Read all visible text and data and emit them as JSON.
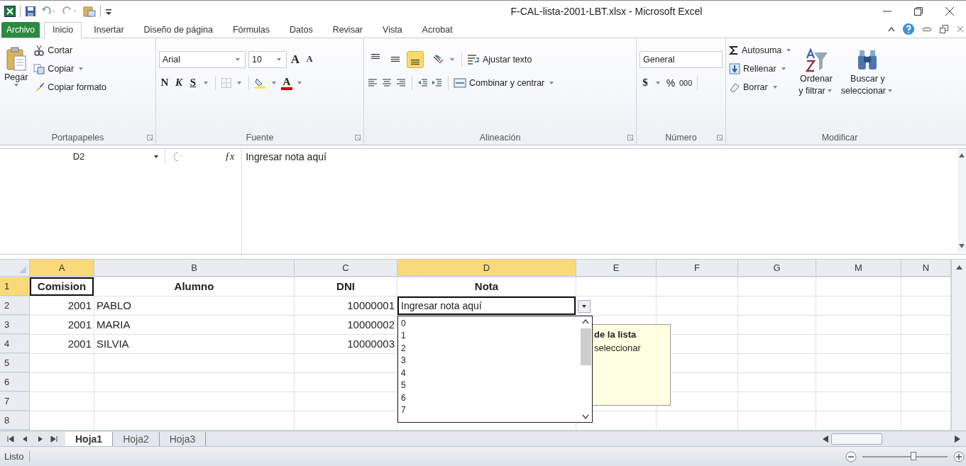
{
  "window": {
    "title": "F-CAL-lista-2001-LBT.xlsx - Microsoft Excel"
  },
  "ribbon_tabs": [
    {
      "label": "Archivo",
      "kind": "file",
      "selected": false
    },
    {
      "label": "Inicio",
      "kind": "tab",
      "selected": true
    },
    {
      "label": "Insertar",
      "kind": "tab",
      "selected": false
    },
    {
      "label": "Diseño de página",
      "kind": "tab",
      "selected": false
    },
    {
      "label": "Fórmulas",
      "kind": "tab",
      "selected": false
    },
    {
      "label": "Datos",
      "kind": "tab",
      "selected": false
    },
    {
      "label": "Revisar",
      "kind": "tab",
      "selected": false
    },
    {
      "label": "Vista",
      "kind": "tab",
      "selected": false
    },
    {
      "label": "Acrobat",
      "kind": "tab",
      "selected": false
    }
  ],
  "clipboard": {
    "label": "Portapapeles",
    "paste": "Pegar",
    "cut": "Cortar",
    "copy": "Copiar",
    "format_painter": "Copiar formato"
  },
  "font": {
    "label": "Fuente",
    "name": "Arial",
    "size": "10",
    "grow": "A",
    "shrink": "A",
    "bold": "N",
    "italic": "K",
    "underline": "S",
    "color_letter": "A"
  },
  "alignment": {
    "label": "Alineación",
    "vertical": [
      {
        "kind": "top",
        "selected": false
      },
      {
        "kind": "middle",
        "selected": false
      },
      {
        "kind": "bottom",
        "selected": true
      }
    ],
    "wrap_text": "Ajustar texto",
    "merge": "Combinar y centrar"
  },
  "number": {
    "label": "Número",
    "format": "General",
    "currency": "$",
    "percent": "%",
    "thousands": "000"
  },
  "editing": {
    "label": "Modificar",
    "autosum": "Autosuma",
    "fill": "Rellenar",
    "clear": "Borrar",
    "sort": [
      "Ordenar",
      "y filtrar"
    ],
    "find": [
      "Buscar y",
      "seleccionar"
    ]
  },
  "formula_bar": {
    "name_box": "D2",
    "function_button": "ƒx",
    "formula": "Ingresar nota aquí"
  },
  "sheet": {
    "columns": [
      {
        "label": "A",
        "highlighted": true
      },
      {
        "label": "B",
        "highlighted": false
      },
      {
        "label": "C",
        "highlighted": false
      },
      {
        "label": "D",
        "highlighted": true
      },
      {
        "label": "E",
        "highlighted": false
      },
      {
        "label": "F",
        "highlighted": false
      },
      {
        "label": "G",
        "highlighted": false
      },
      {
        "label": "M",
        "highlighted": false
      },
      {
        "label": "N",
        "highlighted": false
      }
    ],
    "rows": [
      {
        "label": "1",
        "highlighted": true,
        "cells": [
          {
            "text": "Comision",
            "bold": true,
            "outlined": true
          },
          {
            "text": "Alumno",
            "bold": true
          },
          {
            "text": "DNI",
            "bold": true
          },
          {
            "text": "Nota",
            "bold": true
          }
        ]
      },
      {
        "label": "2",
        "highlighted": false,
        "cells": [
          {
            "text": "2001"
          },
          {
            "text": "PABLO"
          },
          {
            "text": "10000001"
          },
          {
            "text": "Ingresar nota aquí",
            "active": true
          }
        ]
      },
      {
        "label": "3",
        "highlighted": false,
        "cells": [
          {
            "text": "2001"
          },
          {
            "text": "MARIA"
          },
          {
            "text": "10000002"
          }
        ]
      },
      {
        "label": "4",
        "highlighted": false,
        "cells": [
          {
            "text": "2001"
          },
          {
            "text": "SILVIA"
          },
          {
            "text": "10000003"
          }
        ]
      },
      {
        "label": "5",
        "highlighted": false
      },
      {
        "label": "6",
        "highlighted": false
      },
      {
        "label": "7",
        "highlighted": false
      },
      {
        "label": "8",
        "highlighted": false
      }
    ]
  },
  "dropdown": {
    "options": [
      "0",
      "1",
      "2",
      "3",
      "4",
      "5",
      "6",
      "7"
    ]
  },
  "input_message": {
    "title": "de la lista",
    "text": "seleccionar"
  },
  "sheet_tabs": [
    {
      "label": "Hoja1",
      "selected": true
    },
    {
      "label": "Hoja2",
      "selected": false
    },
    {
      "label": "Hoja3",
      "selected": false
    }
  ],
  "status_bar": {
    "text": "Listo",
    "zoom_slider": {
      "level": 0.6
    }
  }
}
